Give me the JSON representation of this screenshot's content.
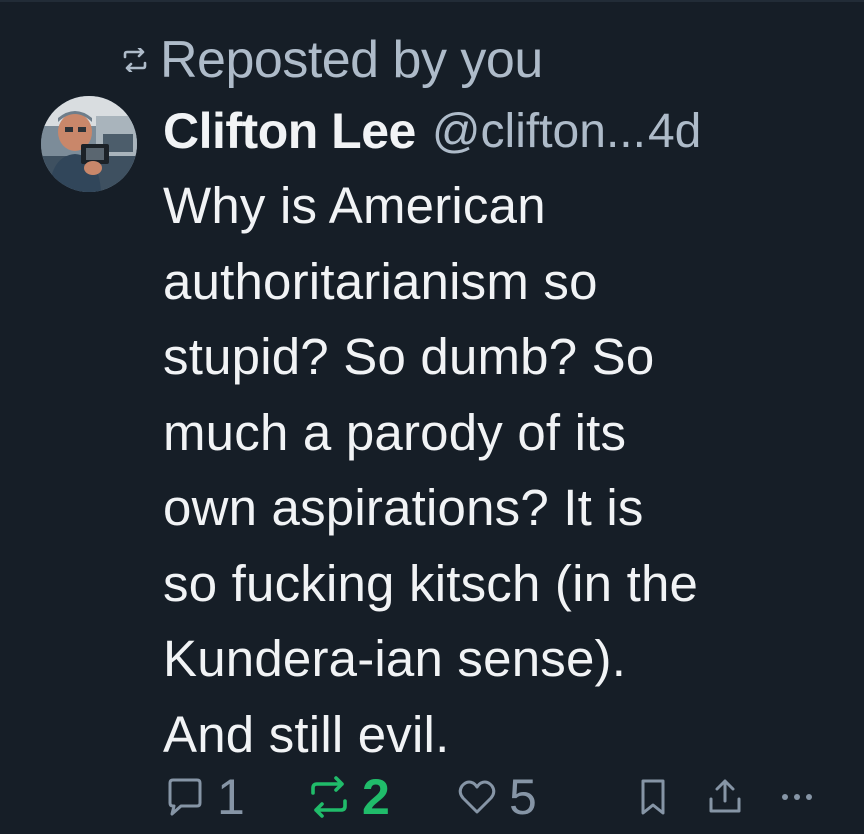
{
  "repost_banner": {
    "label": "Reposted by you",
    "icon": "repost-icon"
  },
  "post": {
    "author": {
      "name": "Clifton Lee",
      "handle": "@clifton...",
      "avatar": "avatar-photo"
    },
    "time": "4d",
    "text": "Why is American\nauthoritarianism so\nstupid? So dumb? So\nmuch a parody of its\nown aspirations? It is\nso fucking kitsch (in the\nKundera-ian sense).\nAnd still evil."
  },
  "actions": {
    "reply": {
      "icon": "reply-icon",
      "count": "1"
    },
    "repost": {
      "icon": "repost-icon",
      "count": "2",
      "active": true
    },
    "like": {
      "icon": "heart-icon",
      "count": "5"
    },
    "bookmark": {
      "icon": "bookmark-icon"
    },
    "share": {
      "icon": "share-icon"
    },
    "more": {
      "icon": "more-icon"
    }
  },
  "colors": {
    "background": "#161e27",
    "text_primary": "#f1f3f5",
    "text_secondary": "#aebbc9",
    "repost_active": "#20bc6a",
    "action_muted": "#8695a6"
  }
}
